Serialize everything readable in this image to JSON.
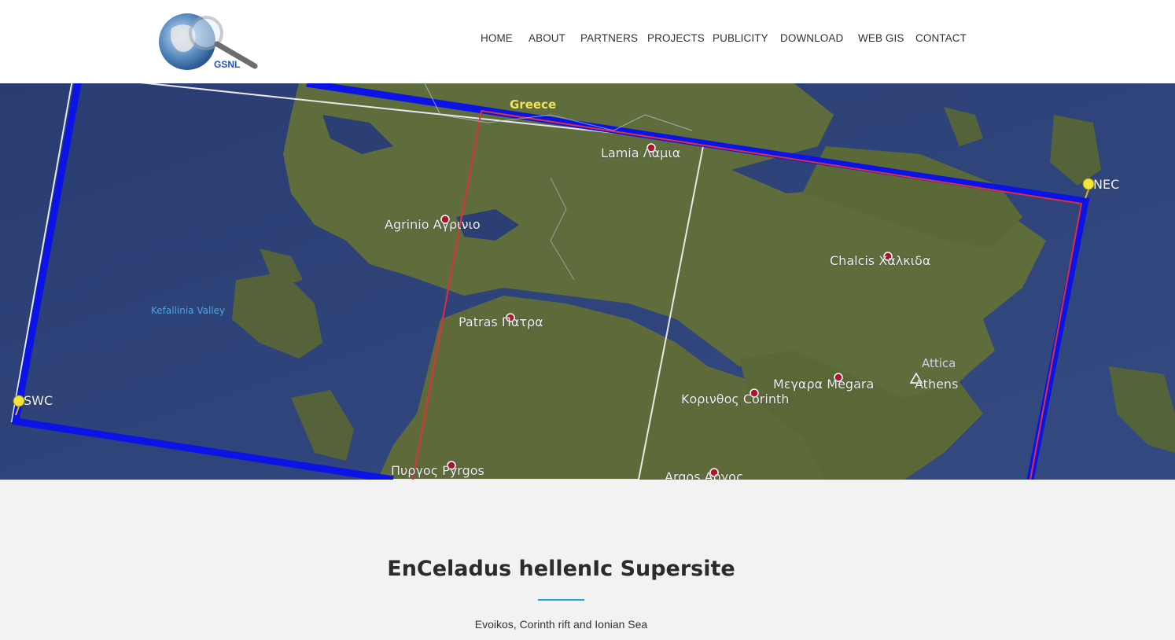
{
  "header": {
    "logo_text": "GSNL",
    "nav": [
      {
        "label": "HOME"
      },
      {
        "label": "ABOUT"
      },
      {
        "label": "PARTNERS"
      },
      {
        "label": "PROJECTS"
      },
      {
        "label": "PUBLICITY"
      },
      {
        "label": "DOWNLOAD"
      },
      {
        "label": "WEB GIS"
      },
      {
        "label": "CONTACT"
      }
    ]
  },
  "hero": {
    "labels": {
      "greece": "Greece",
      "lamia": "Lamia Λαμια",
      "agrinio": "Agrinio Αγρινιο",
      "kefallinia": "Kefallinia Valley",
      "patras": "Patras Πατρα",
      "chalcis": "Chalcis Χαλκιδα",
      "attica": "Attica",
      "megara": "Μεγαρα Megara",
      "athens": "Athens",
      "korinthos": "Κορινθος Corinth",
      "pyrgos": "Πυργος Pyrgos",
      "argos": "Argos Αργος",
      "nec": "NEC",
      "swc": "SWC"
    },
    "colors": {
      "sea": "#2c3f74",
      "land": "#5b6a3b",
      "frame": "#0a14e6",
      "inner_frame": "#e0303a"
    }
  },
  "content": {
    "title": "EnCeladus hellenIc Supersite",
    "subtitle": "Evoikos, Corinth rift and Ionian Sea",
    "accent": "#2aa4e8"
  }
}
